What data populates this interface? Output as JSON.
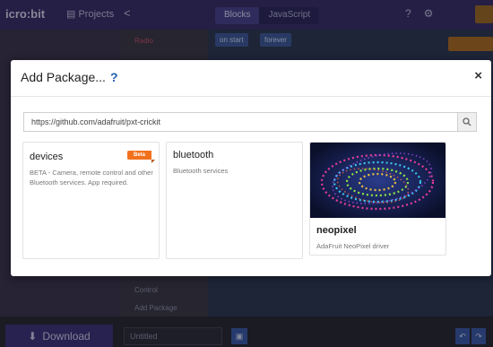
{
  "background": {
    "brand": "icro:bit",
    "nav_projects": "Projects",
    "mode_blocks": "Blocks",
    "mode_javascript": "JavaScript",
    "toolbox": [
      "Radio",
      "Control",
      "Add Package"
    ],
    "workspace_blocks": [
      "on start",
      "forever"
    ],
    "download_label": "Download",
    "project_name": "Untitled"
  },
  "modal": {
    "title": "Add Package...",
    "help": "?",
    "close": "×",
    "search_value": "https://github.com/adafruit/pxt-crickit",
    "packages": [
      {
        "name": "devices",
        "description": "BETA - Camera, remote control and other Bluetooth services. App required.",
        "badge": "Beta"
      },
      {
        "name": "bluetooth",
        "description": "Bluetooth services"
      },
      {
        "name": "neopixel",
        "description": "AdaFruit NeoPixel driver"
      }
    ]
  },
  "colors": {
    "accent": "#1f5fae",
    "beta": "#f2711c",
    "topbar": "#3a2f6b"
  }
}
